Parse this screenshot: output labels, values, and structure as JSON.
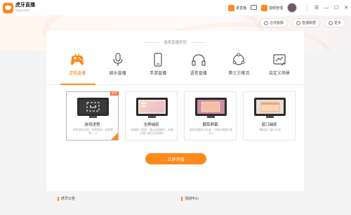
{
  "app": {
    "name": "虎牙直播",
    "name_en": "huya.com"
  },
  "toolbar": {
    "record_label": "录直播",
    "video_label": "视频管理"
  },
  "window_controls": [
    "☰",
    "—",
    "☐",
    "✕"
  ],
  "pills": [
    {
      "label": "在线客服",
      "icon": "headset-icon"
    },
    {
      "label": "直播数据",
      "icon": "data-icon"
    },
    {
      "label": "更多",
      "icon": "more-icon"
    }
  ],
  "main": {
    "title": "选择直播类型",
    "types": [
      {
        "label": "游戏直播",
        "icon": "gamepad-icon",
        "active": true
      },
      {
        "label": "娱乐直播",
        "icon": "microphone-icon",
        "active": false
      },
      {
        "label": "手游直播",
        "icon": "phone-icon",
        "active": false
      },
      {
        "label": "语音直播",
        "icon": "headphones-icon",
        "active": false
      },
      {
        "label": "第三方推流",
        "icon": "share-icon",
        "active": false
      },
      {
        "label": "自定义场景",
        "icon": "custom-scene-icon",
        "active": false
      }
    ],
    "modes": [
      {
        "name": "游戏进程",
        "desc": "读取游戏进程，帧率更高，画面更稳，CF",
        "badge": "推荐",
        "active": true
      },
      {
        "name": "全屏捕捉",
        "desc": "直播整个屏幕，通过全屏模式，调整为窗口或无边框模式",
        "active": false
      },
      {
        "name": "截取屏幕",
        "desc": "截取屏幕部分区域，可拖拉调整区域大小",
        "active": false
      },
      {
        "name": "窗口捕捉",
        "desc": "捕捉某个窗口区域",
        "active": false
      }
    ],
    "start_label": "立即开播"
  },
  "footer": {
    "left_title": "虎牙公告",
    "right_title": "活动中心"
  },
  "colors": {
    "accent": "#ff8a1c",
    "text": "#333333"
  }
}
